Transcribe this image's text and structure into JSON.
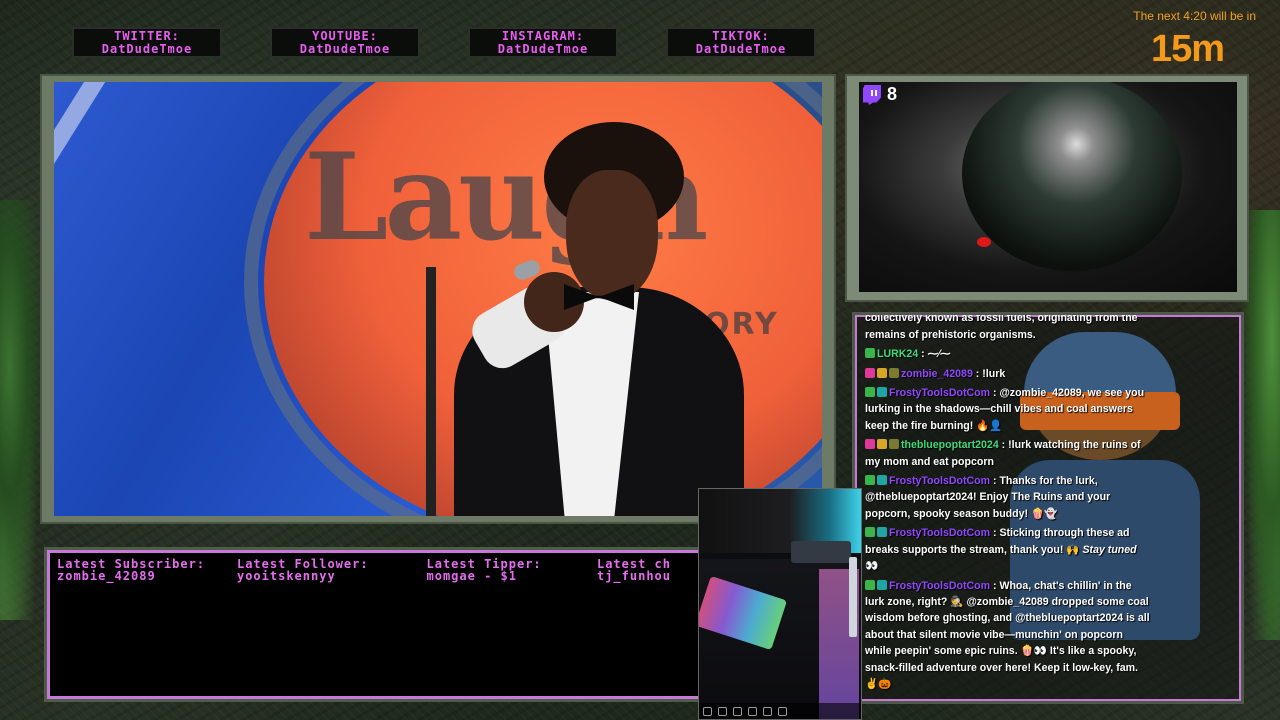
{
  "socials": [
    {
      "platform": "TWITTER:",
      "handle": "DatDudeTmoe"
    },
    {
      "platform": "YOUTUBE:",
      "handle": "DatDudeTmoe"
    },
    {
      "platform": "INSTAGRAM:",
      "handle": "DatDudeTmoe"
    },
    {
      "platform": "TIKTOK:",
      "handle": "DatDudeTmoe"
    }
  ],
  "countdown": {
    "text": "The next 4:20 will be in",
    "value": "15m"
  },
  "stage": {
    "logo": "Laugh",
    "sub": "ORY"
  },
  "viewer_count": "8",
  "ticker": [
    {
      "label": "Latest Subscriber:",
      "value": "zombie_42089"
    },
    {
      "label": "Latest Follower:",
      "value": "yooitskennyy"
    },
    {
      "label": "Latest Tipper:",
      "value": "momgae - $1"
    },
    {
      "label": "Latest ch",
      "value": "tj_funhou"
    }
  ],
  "chat": [
    {
      "badges": [
        "b-green",
        "b-teal"
      ],
      "user": "FrostyToolsDotCom",
      "color": "#9146ff",
      "text": "Coal, oil, and natural gas are collectively known as fossil fuels, originating from the remains of prehistoric organisms."
    },
    {
      "badges": [
        "b-green"
      ],
      "user": "LURK24",
      "color": "#3fd97a",
      "text": "⁓⁄⁓"
    },
    {
      "badges": [
        "b-pink",
        "b-gold",
        "b-olive"
      ],
      "user": "zombie_42089",
      "color": "#9146ff",
      "text": "!lurk"
    },
    {
      "badges": [
        "b-green",
        "b-teal"
      ],
      "user": "FrostyToolsDotCom",
      "color": "#9146ff",
      "text": "@zombie_42089, we see you lurking in the shadows—chill vibes and coal answers keep the fire burning! 🔥👤"
    },
    {
      "badges": [
        "b-pink",
        "b-gold",
        "b-olive"
      ],
      "user": "thebluepoptart2024",
      "color": "#3fd97a",
      "text": "!lurk watching the ruins of my mom and eat popcorn"
    },
    {
      "badges": [
        "b-green",
        "b-teal"
      ],
      "user": "FrostyToolsDotCom",
      "color": "#9146ff",
      "text": "Thanks for the lurk, @thebluepoptart2024! Enjoy The Ruins and your popcorn, spooky season buddy! 🍿👻"
    },
    {
      "badges": [
        "b-green",
        "b-teal"
      ],
      "user": "FrostyToolsDotCom",
      "color": "#9146ff",
      "text": "Sticking through these ad breaks supports the stream, thank you! 🙌",
      "extra": "Stay tuned",
      "tail": "👀"
    },
    {
      "badges": [
        "b-green",
        "b-teal"
      ],
      "user": "FrostyToolsDotCom",
      "color": "#9146ff",
      "text": "Whoa, chat's chillin' in the lurk zone, right? 🕵️ @zombie_42089 dropped some coal wisdom before ghosting, and @thebluepoptart2024 is all about that silent movie vibe—munchin' on popcorn while peepin' some epic ruins. 🍿👀 It's like a spooky, snack-filled adventure over here! Keep it low-key, fam. ✌️🎃"
    }
  ]
}
